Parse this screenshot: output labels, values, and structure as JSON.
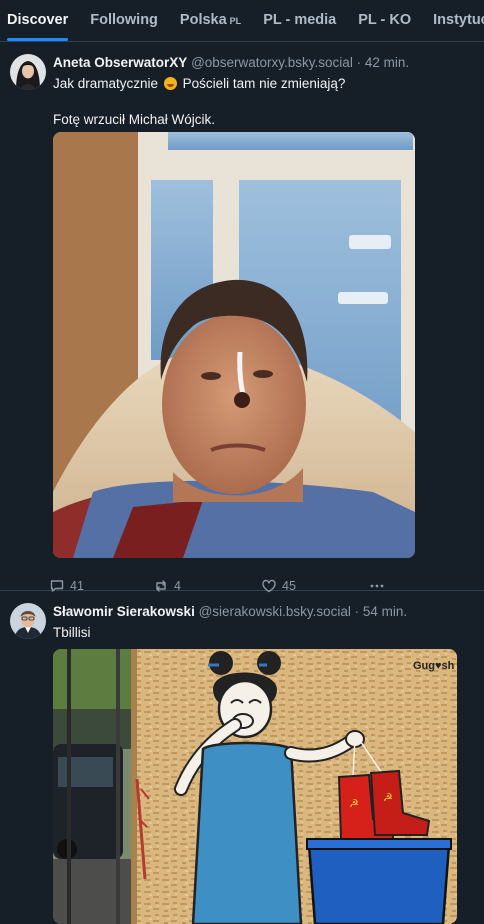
{
  "tabs": [
    {
      "label": "Discover",
      "sub": ""
    },
    {
      "label": "Following",
      "sub": ""
    },
    {
      "label": "Polska",
      "sub": "PL"
    },
    {
      "label": "PL - media",
      "sub": ""
    },
    {
      "label": "PL - KO",
      "sub": ""
    },
    {
      "label": "Instytucje",
      "sub": ""
    }
  ],
  "active_tab": "Discover",
  "posts": [
    {
      "author": "Aneta ObserwatorXY",
      "handle": "@obserwatorxy.bsky.social",
      "separator": "·",
      "time": "42 min.",
      "text_line1_before": "Jak dramatycznie",
      "emoji": "flushed-face-emoji",
      "text_line1_after": "Pościeli tam nie zmieniają?",
      "text_line2": "Fotę wrzucił Michał Wójcik.",
      "image": "photo-man-in-hospital-bed",
      "replies": "41",
      "reposts": "4",
      "likes": "45"
    },
    {
      "author": "Sławomir Sierakowski",
      "handle": "@sierakowski.bsky.social",
      "separator": "·",
      "time": "54 min.",
      "text": "Tbillisi",
      "image": "photo-street-mural-girl-holding-boots",
      "mural_signature": "Gug♥sh"
    }
  ],
  "icons": {
    "reply": "speech-bubble-icon",
    "repost": "repost-arrows-icon",
    "like": "heart-icon",
    "more": "ellipsis-icon"
  },
  "colors": {
    "background": "#161e27",
    "accent": "#208bfe",
    "muted": "#8b98a5",
    "divider": "#2e4052"
  }
}
